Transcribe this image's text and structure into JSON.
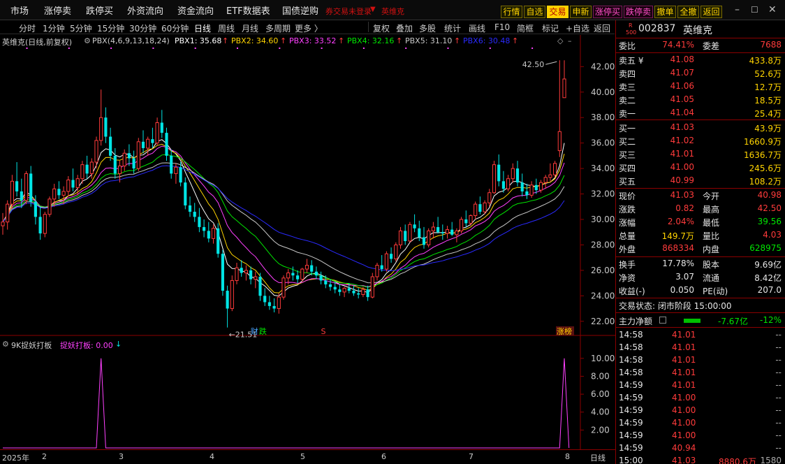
{
  "topmenu": {
    "items": [
      "市场",
      "涨停卖",
      "跌停买",
      "外资流向",
      "资金流向",
      "ETF数据表",
      "国债逆购"
    ],
    "notice": "券交易未登录",
    "stock_tag": "英维克",
    "buttons": [
      "行情",
      "自选",
      "交易",
      "申新",
      "涨停买",
      "跌停卖",
      "撤单",
      "全撤",
      "返回"
    ]
  },
  "window": {
    "minimize": "–",
    "restore": "☐",
    "close": "✕"
  },
  "periodbar": {
    "left": [
      "分时",
      "1分钟",
      "5分钟",
      "15分钟",
      "30分钟",
      "60分钟",
      "日线",
      "周线",
      "月线",
      "多周期",
      "更多 〉"
    ],
    "active": "日线",
    "right": [
      "复权",
      "叠加",
      "多股",
      "统计",
      "画线",
      "F10",
      "简框",
      "标记",
      "+自选",
      "返回"
    ]
  },
  "main_indicator": {
    "title": "英维克(日线,前复权)",
    "name": "PBX(4,6,9,13,18,24)",
    "labels": [
      {
        "text": "PBX1: 35.68",
        "arrow": "↑",
        "color": "#ffffff"
      },
      {
        "text": "PBX2: 34.60",
        "arrow": "↑",
        "color": "#ffd400"
      },
      {
        "text": "PBX3: 33.52",
        "arrow": "↑",
        "color": "#ff40ff"
      },
      {
        "text": "PBX4: 32.16",
        "arrow": "↑",
        "color": "#00e600"
      },
      {
        "text": "PBX5: 31.10",
        "arrow": "↑",
        "color": "#c8c8c8"
      },
      {
        "text": "PBX6: 30.48",
        "arrow": "↑",
        "color": "#2a2aff"
      }
    ],
    "max_label": "42.50",
    "min_label": "←21.51",
    "event_markers": [
      "财",
      "跌",
      "S",
      "涨榜"
    ]
  },
  "y_axis_main": [
    "42.00",
    "40.00",
    "38.00",
    "36.00",
    "34.00",
    "32.00",
    "30.00",
    "28.00",
    "26.00",
    "24.00",
    "22.00"
  ],
  "sub_indicator": {
    "name": "9K捉妖打板",
    "label": "捉妖打板: 0.00",
    "arrow": "↓",
    "y_axis": [
      "10.00",
      "8.00",
      "6.00",
      "4.00",
      "2.00"
    ]
  },
  "x_axis": {
    "labels": [
      "2025年",
      "2",
      "3",
      "4",
      "5",
      "6",
      "7",
      "8"
    ],
    "right_label": "日线"
  },
  "quote": {
    "code": "002837",
    "name": "英维克",
    "badge_top": "R",
    "badge_bottom": "500",
    "weibi_label": "委比",
    "weibi": "74.41%",
    "weicha_label": "委差",
    "weicha": "7688",
    "asks": [
      {
        "label": "卖五 ¥",
        "price": "41.08",
        "vol": "433.8万"
      },
      {
        "label": "卖四",
        "price": "41.07",
        "vol": "52.6万"
      },
      {
        "label": "卖三",
        "price": "41.06",
        "vol": "12.7万"
      },
      {
        "label": "卖二",
        "price": "41.05",
        "vol": "18.5万"
      },
      {
        "label": "卖一",
        "price": "41.04",
        "vol": "25.4万"
      }
    ],
    "bids": [
      {
        "label": "买一",
        "price": "41.03",
        "vol": "43.9万"
      },
      {
        "label": "买二",
        "price": "41.02",
        "vol": "1660.9万"
      },
      {
        "label": "买三",
        "price": "41.01",
        "vol": "1636.7万"
      },
      {
        "label": "买四",
        "price": "41.00",
        "vol": "245.6万"
      },
      {
        "label": "买五",
        "price": "40.99",
        "vol": "108.2万"
      }
    ],
    "stats": [
      {
        "l1": "现价",
        "v1": "41.03",
        "c1": "red",
        "l2": "今开",
        "v2": "40.98",
        "c2": "red"
      },
      {
        "l1": "涨跌",
        "v1": "0.82",
        "c1": "red",
        "l2": "最高",
        "v2": "42.50",
        "c2": "red"
      },
      {
        "l1": "涨幅",
        "v1": "2.04%",
        "c1": "red",
        "l2": "最低",
        "v2": "39.56",
        "c2": "green"
      },
      {
        "l1": "总量",
        "v1": "149.7万",
        "c1": "yellow",
        "l2": "量比",
        "v2": "4.03",
        "c2": "red"
      },
      {
        "l1": "外盘",
        "v1": "868334",
        "c1": "red",
        "l2": "内盘",
        "v2": "628975",
        "c2": "green"
      }
    ],
    "stats2": [
      {
        "l1": "换手",
        "v1": "17.78%",
        "c1": "white",
        "l2": "股本",
        "v2": "9.69亿",
        "c2": "white"
      },
      {
        "l1": "净资",
        "v1": "3.07",
        "c1": "white",
        "l2": "流通",
        "v2": "8.42亿",
        "c2": "white"
      },
      {
        "l1": "收益(-)",
        "v1": "0.050",
        "c1": "white",
        "l2": "PE(动)",
        "v2": "207.0",
        "c2": "white"
      }
    ],
    "trade_status": "交易状态: 闭市阶段 15:00:00",
    "main_flow_label": "主力净额",
    "main_flow_value": "-7.67亿",
    "main_flow_pct": "-12%",
    "ticks": [
      {
        "time": "14:58",
        "price": "41.01",
        "vol": "--"
      },
      {
        "time": "14:58",
        "price": "41.01",
        "vol": "--"
      },
      {
        "time": "14:58",
        "price": "41.01",
        "vol": "--"
      },
      {
        "time": "14:58",
        "price": "41.01",
        "vol": "--"
      },
      {
        "time": "14:59",
        "price": "41.01",
        "vol": "--"
      },
      {
        "time": "14:59",
        "price": "41.00",
        "vol": "--"
      },
      {
        "time": "14:59",
        "price": "41.00",
        "vol": "--"
      },
      {
        "time": "14:59",
        "price": "41.00",
        "vol": "--"
      },
      {
        "time": "14:59",
        "price": "41.00",
        "vol": "--"
      },
      {
        "time": "14:59",
        "price": "40.94",
        "vol": "--"
      },
      {
        "time": "15:00",
        "price": "41.03",
        "vol": "8880.6万",
        "extra": "1580"
      }
    ]
  },
  "colors": {
    "up": "#ff3b3b",
    "down": "#00e5e5",
    "pbx1": "#ffffff",
    "pbx2": "#ffd400",
    "pbx3": "#ff40ff",
    "pbx4": "#00e600",
    "pbx5": "#c8c8c8",
    "pbx6": "#2a2aff",
    "sub": "#ff40ff"
  },
  "chart_data": [
    {
      "type": "candlestick",
      "title": "英维克(日线,前复权)",
      "ylim": [
        21,
        43.5
      ],
      "y_ticks": [
        22,
        24,
        26,
        28,
        30,
        32,
        34,
        36,
        38,
        40,
        42
      ],
      "candles_ohlc": [
        [
          29.5,
          30.5,
          28.8,
          29.8
        ],
        [
          29.8,
          31.5,
          29.2,
          31.2
        ],
        [
          31.2,
          33.5,
          30.8,
          33.0
        ],
        [
          33.0,
          34.5,
          31.8,
          32.2
        ],
        [
          32.2,
          33.2,
          30.9,
          31.5
        ],
        [
          31.5,
          33.8,
          31.2,
          33.6
        ],
        [
          33.6,
          34.2,
          31.0,
          31.4
        ],
        [
          31.4,
          31.9,
          29.6,
          30.2
        ],
        [
          30.2,
          31.0,
          28.4,
          28.9
        ],
        [
          28.9,
          30.6,
          28.6,
          30.4
        ],
        [
          30.4,
          31.8,
          30.2,
          31.6
        ],
        [
          31.6,
          32.8,
          31.0,
          32.4
        ],
        [
          32.4,
          33.0,
          31.6,
          31.9
        ],
        [
          31.9,
          32.6,
          31.2,
          32.2
        ],
        [
          32.2,
          33.4,
          31.8,
          33.1
        ],
        [
          33.1,
          34.0,
          32.2,
          32.5
        ],
        [
          32.5,
          33.5,
          31.9,
          33.2
        ],
        [
          33.2,
          34.6,
          32.8,
          34.3
        ],
        [
          34.3,
          35.0,
          33.2,
          33.6
        ],
        [
          33.6,
          34.8,
          33.2,
          34.5
        ],
        [
          34.5,
          36.5,
          34.0,
          36.2
        ],
        [
          36.2,
          40.2,
          35.8,
          38.0
        ],
        [
          38.0,
          38.8,
          36.0,
          36.5
        ],
        [
          36.5,
          37.2,
          34.6,
          35.0
        ],
        [
          35.0,
          35.6,
          33.2,
          33.6
        ],
        [
          33.6,
          34.6,
          32.9,
          34.2
        ],
        [
          34.2,
          35.5,
          33.8,
          35.2
        ],
        [
          35.2,
          35.9,
          34.2,
          34.8
        ],
        [
          34.8,
          35.4,
          33.6,
          34.0
        ],
        [
          34.0,
          36.4,
          33.8,
          36.1
        ],
        [
          36.1,
          37.0,
          35.2,
          35.6
        ],
        [
          35.6,
          36.5,
          35.0,
          36.3
        ],
        [
          36.3,
          37.2,
          35.6,
          36.0
        ],
        [
          36.0,
          38.0,
          35.8,
          37.6
        ],
        [
          37.6,
          38.6,
          36.4,
          36.8
        ],
        [
          36.8,
          37.2,
          34.6,
          35.0
        ],
        [
          35.0,
          35.5,
          33.2,
          33.6
        ],
        [
          33.6,
          34.4,
          32.8,
          34.1
        ],
        [
          34.1,
          34.5,
          32.6,
          32.9
        ],
        [
          32.9,
          33.3,
          30.8,
          31.1
        ],
        [
          31.1,
          31.8,
          30.2,
          30.6
        ],
        [
          30.6,
          31.3,
          29.8,
          30.2
        ],
        [
          30.2,
          30.9,
          29.0,
          29.4
        ],
        [
          29.4,
          30.0,
          28.6,
          29.1
        ],
        [
          29.1,
          29.8,
          28.2,
          28.5
        ],
        [
          28.5,
          29.6,
          28.1,
          29.3
        ],
        [
          29.3,
          29.7,
          27.0,
          27.3
        ],
        [
          27.3,
          27.6,
          24.0,
          24.4
        ],
        [
          24.4,
          24.8,
          21.51,
          23.0
        ],
        [
          23.0,
          25.6,
          22.8,
          25.2
        ],
        [
          25.2,
          26.6,
          24.9,
          26.2
        ],
        [
          26.2,
          26.8,
          25.5,
          25.8
        ],
        [
          25.8,
          26.4,
          25.2,
          26.0
        ],
        [
          26.0,
          26.3,
          24.9,
          25.3
        ],
        [
          25.3,
          25.9,
          24.6,
          25.5
        ],
        [
          25.5,
          25.8,
          23.6,
          24.0
        ],
        [
          24.0,
          24.6,
          23.2,
          23.5
        ],
        [
          23.5,
          24.0,
          22.9,
          23.2
        ],
        [
          23.2,
          23.8,
          22.7,
          23.0
        ],
        [
          23.0,
          24.2,
          22.6,
          23.9
        ],
        [
          23.9,
          25.6,
          23.7,
          25.4
        ],
        [
          25.4,
          26.1,
          24.9,
          25.8
        ],
        [
          25.8,
          26.3,
          25.2,
          25.6
        ],
        [
          25.6,
          26.0,
          25.0,
          25.3
        ],
        [
          25.3,
          26.2,
          25.1,
          26.1
        ],
        [
          26.1,
          26.9,
          25.8,
          26.4
        ],
        [
          26.4,
          26.8,
          25.6,
          25.9
        ],
        [
          25.9,
          26.3,
          25.3,
          25.6
        ],
        [
          25.6,
          25.9,
          24.9,
          25.2
        ],
        [
          25.2,
          25.6,
          24.6,
          24.9
        ],
        [
          24.9,
          25.3,
          24.4,
          24.7
        ],
        [
          24.7,
          25.1,
          24.2,
          24.5
        ],
        [
          24.5,
          24.9,
          24.0,
          24.3
        ],
        [
          24.3,
          24.7,
          23.9,
          24.6
        ],
        [
          24.6,
          25.0,
          24.2,
          24.4
        ],
        [
          24.4,
          24.8,
          24.0,
          24.2
        ],
        [
          24.2,
          24.6,
          23.8,
          24.1
        ],
        [
          24.1,
          24.7,
          23.9,
          24.5
        ],
        [
          24.5,
          24.8,
          23.6,
          23.9
        ],
        [
          23.9,
          25.8,
          23.8,
          25.5
        ],
        [
          25.5,
          26.6,
          25.2,
          26.4
        ],
        [
          26.4,
          27.2,
          25.9,
          26.1
        ],
        [
          26.1,
          27.5,
          25.9,
          27.3
        ],
        [
          27.3,
          27.8,
          26.6,
          26.9
        ],
        [
          26.9,
          28.2,
          26.7,
          28.0
        ],
        [
          28.0,
          29.4,
          27.7,
          29.1
        ],
        [
          29.1,
          29.6,
          28.0,
          28.3
        ],
        [
          28.3,
          29.8,
          28.2,
          29.6
        ],
        [
          29.6,
          30.4,
          29.0,
          29.3
        ],
        [
          29.3,
          29.9,
          28.3,
          28.6
        ],
        [
          28.6,
          29.4,
          27.7,
          28.0
        ],
        [
          28.0,
          29.3,
          27.8,
          29.1
        ],
        [
          29.1,
          29.8,
          28.5,
          29.4
        ],
        [
          29.4,
          30.2,
          28.9,
          29.0
        ],
        [
          29.0,
          29.6,
          28.4,
          28.9
        ],
        [
          28.9,
          29.5,
          28.5,
          29.2
        ],
        [
          29.2,
          29.8,
          28.7,
          28.8
        ],
        [
          28.8,
          29.3,
          28.2,
          29.1
        ],
        [
          29.1,
          30.2,
          28.9,
          30.0
        ],
        [
          30.0,
          30.7,
          29.4,
          29.7
        ],
        [
          29.7,
          30.4,
          29.5,
          30.3
        ],
        [
          30.3,
          31.4,
          30.0,
          31.2
        ],
        [
          31.2,
          31.8,
          30.4,
          30.6
        ],
        [
          30.6,
          31.5,
          30.4,
          31.3
        ],
        [
          31.3,
          32.4,
          31.0,
          32.1
        ],
        [
          32.1,
          34.6,
          32.0,
          34.3
        ],
        [
          34.3,
          35.1,
          32.6,
          33.0
        ],
        [
          33.0,
          33.8,
          32.1,
          32.4
        ],
        [
          32.4,
          33.5,
          32.2,
          33.2
        ],
        [
          33.2,
          34.4,
          32.9,
          34.0
        ],
        [
          34.0,
          34.6,
          32.6,
          32.9
        ],
        [
          32.9,
          33.6,
          31.8,
          32.2
        ],
        [
          32.2,
          32.8,
          31.6,
          31.9
        ],
        [
          31.9,
          33.0,
          31.7,
          32.7
        ],
        [
          32.7,
          33.2,
          32.0,
          32.3
        ],
        [
          32.3,
          33.1,
          32.1,
          32.9
        ],
        [
          32.9,
          33.5,
          32.4,
          33.3
        ],
        [
          33.3,
          34.4,
          33.0,
          33.5
        ],
        [
          33.5,
          34.6,
          33.3,
          34.4
        ],
        [
          35.4,
          42.5,
          34.9,
          36.9
        ],
        [
          39.56,
          42.5,
          39.56,
          41.03
        ]
      ],
      "ma_series": [
        {
          "name": "PBX1",
          "last": 35.68
        },
        {
          "name": "PBX2",
          "last": 34.6
        },
        {
          "name": "PBX3",
          "last": 33.52
        },
        {
          "name": "PBX4",
          "last": 32.16
        },
        {
          "name": "PBX5",
          "last": 31.1
        },
        {
          "name": "PBX6",
          "last": 30.48
        }
      ]
    },
    {
      "type": "line",
      "title": "9K捉妖打板",
      "ylim": [
        0,
        11
      ],
      "y_ticks": [
        2,
        4,
        6,
        8,
        10
      ],
      "spike_index": [
        21,
        120
      ],
      "spike_value": 10
    }
  ]
}
